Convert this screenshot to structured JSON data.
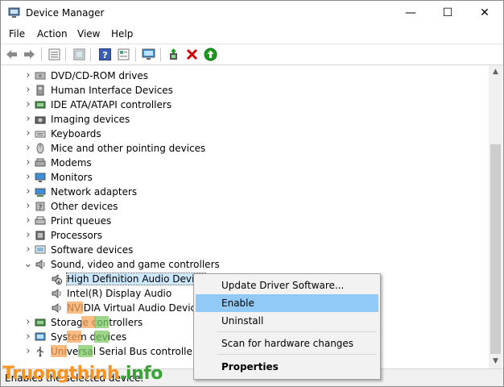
{
  "window": {
    "title": "Device Manager",
    "minimize": "—",
    "maximize": "☐",
    "close": "✕"
  },
  "menu": [
    "File",
    "Action",
    "View",
    "Help"
  ],
  "toolbar": [
    "back-icon",
    "forward-icon",
    "properties-icon",
    "view-icon",
    "help-icon",
    "details-icon",
    "scan-monitor-icon",
    "update-driver-icon",
    "uninstall-icon",
    "enable-icon"
  ],
  "tree": [
    {
      "label": "DVD/CD-ROM drives",
      "icon": "dvd-drive-icon"
    },
    {
      "label": "Human Interface Devices",
      "icon": "hid-icon"
    },
    {
      "label": "IDE ATA/ATAPI controllers",
      "icon": "ide-controller-icon"
    },
    {
      "label": "Imaging devices",
      "icon": "camera-icon"
    },
    {
      "label": "Keyboards",
      "icon": "keyboard-icon"
    },
    {
      "label": "Mice and other pointing devices",
      "icon": "mouse-icon"
    },
    {
      "label": "Modems",
      "icon": "modem-icon"
    },
    {
      "label": "Monitors",
      "icon": "monitor-icon"
    },
    {
      "label": "Network adapters",
      "icon": "network-icon"
    },
    {
      "label": "Other devices",
      "icon": "other-devices-icon"
    },
    {
      "label": "Print queues",
      "icon": "printer-icon"
    },
    {
      "label": "Processors",
      "icon": "processor-icon"
    },
    {
      "label": "Software devices",
      "icon": "software-device-icon"
    },
    {
      "label": "Sound, video and game controllers",
      "icon": "speaker-icon"
    },
    {
      "label": "High Definition Audio Device",
      "icon": "speaker-disabled-icon"
    },
    {
      "label": "Intel(R) Display Audio",
      "icon": "speaker-icon"
    },
    {
      "label": "NVIDIA Virtual Audio Device (",
      "icon": "speaker-icon"
    },
    {
      "label": "Storage controllers",
      "icon": "storage-icon"
    },
    {
      "label": "System devices",
      "icon": "system-icon"
    },
    {
      "label": "Universal Serial Bus controllers",
      "icon": "usb-icon"
    }
  ],
  "context_menu": {
    "update": "Update Driver Software...",
    "enable": "Enable",
    "uninstall": "Uninstall",
    "scan": "Scan for hardware changes",
    "properties": "Properties"
  },
  "status": "Enables the selected device.",
  "watermark": {
    "part1": "Truongthinh",
    "part2": ".info"
  },
  "colors": {
    "selection": "#cce8ff",
    "menu_highlight": "#91c9f7",
    "uninstall_red": "#d40000",
    "enable_green": "#1a9d1a"
  }
}
